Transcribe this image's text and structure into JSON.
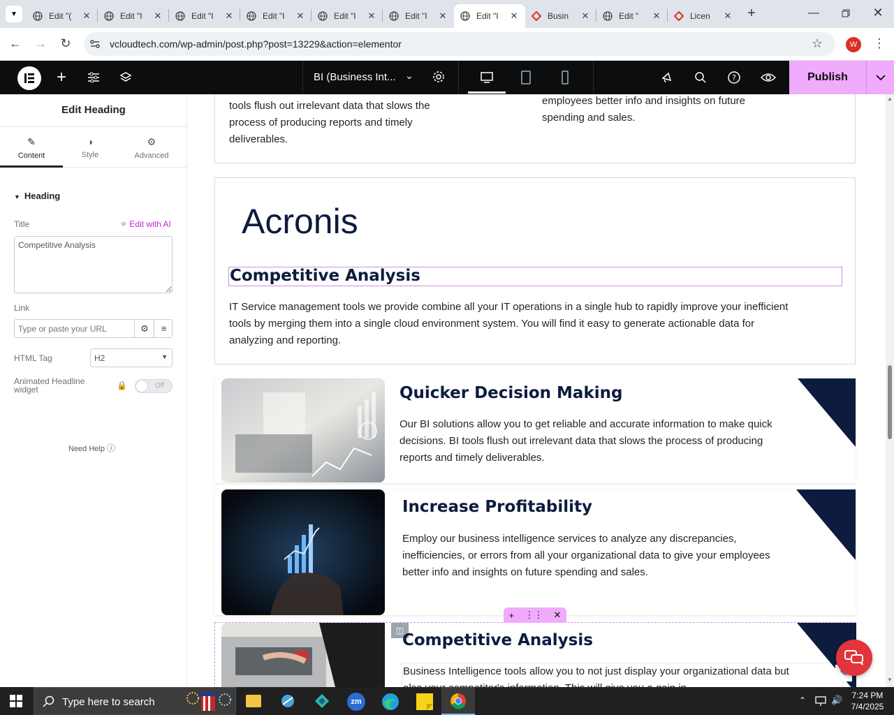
{
  "browser": {
    "tabs": [
      {
        "title": "Edit \"(",
        "active": false
      },
      {
        "title": "Edit \"I",
        "active": false
      },
      {
        "title": "Edit \"I",
        "active": false
      },
      {
        "title": "Edit \"I",
        "active": false
      },
      {
        "title": "Edit \"I",
        "active": false
      },
      {
        "title": "Edit \"I",
        "active": false
      },
      {
        "title": "Edit \"I",
        "active": true
      },
      {
        "title": "Busin",
        "active": false
      },
      {
        "title": "Edit \"",
        "active": false
      },
      {
        "title": "Licen",
        "active": false
      }
    ],
    "url": "vcloudtech.com/wp-admin/post.php?post=13229&action=elementor",
    "profile_initial": "W"
  },
  "topbar": {
    "page_title": "BI (Business Int...",
    "publish_label": "Publish"
  },
  "panel": {
    "header": "Edit Heading",
    "tabs": [
      {
        "label": "Content",
        "icon": "pencil-icon",
        "active": true
      },
      {
        "label": "Style",
        "icon": "half-circle-icon",
        "active": false
      },
      {
        "label": "Advanced",
        "icon": "gear-icon",
        "active": false
      }
    ],
    "section_title": "Heading",
    "title_label": "Title",
    "edit_ai_label": "Edit with AI",
    "title_value": "Competitive Analysis",
    "link_label": "Link",
    "link_placeholder": "Type or paste your URL",
    "html_tag_label": "HTML Tag",
    "html_tag_value": "H2",
    "animated_label": "Animated Headline widget",
    "toggle_state": "Off",
    "need_help": "Need Help"
  },
  "canvas": {
    "card1_left_text": "tools flush out irrelevant data that slows the process of producing reports and timely deliverables.",
    "card1_right_text": "errors from all your organizational data to give your employees better info and insights on future spending and sales.",
    "logo_text": "Acronis",
    "card2_heading": "Competitive Analysis",
    "card2_text": "IT Service management tools we provide combine all your IT operations in a single hub to rapidly improve your inefficient tools by merging them into a single cloud environment system. You will find it easy to generate actionable data for analyzing and reporting.",
    "rows": [
      {
        "heading": "Quicker Decision Making",
        "text": "Our BI solutions allow you to get reliable and accurate information to make quick decisions. BI tools flush out irrelevant data that slows the process of producing reports and timely deliverables."
      },
      {
        "heading": "Increase Profitability",
        "text": "Employ our business intelligence services to analyze any discrepancies, inefficiencies, or errors from all your organizational data to give your employees better info and insights on future spending and sales."
      },
      {
        "heading": "Competitive Analysis",
        "text": "Business Intelligence tools allow you to not just display your organizational data but also your competitor's information. This will give you a gain in"
      }
    ]
  },
  "taskbar": {
    "search_placeholder": "Type here to search",
    "time": "7:24 PM",
    "date": "7/4/2025"
  },
  "colors": {
    "navy": "#0d1b3e",
    "publish_bg": "#f0abfc",
    "accent_pink": "#c026d3",
    "chat_red": "#e2343b"
  }
}
